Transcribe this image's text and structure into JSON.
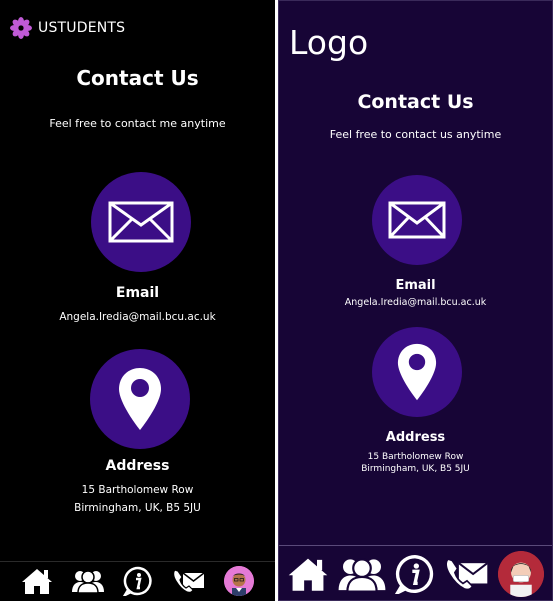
{
  "colors": {
    "accent": "#3b0e86",
    "left_bg": "#000000",
    "right_bg": "#170536",
    "flower": "#c05ad6",
    "avatar_left": "#e57ad6",
    "avatar_right": "#b42a3a"
  },
  "left": {
    "brand": "USTUDENTS",
    "title": "Contact Us",
    "subtitle": "Feel free to contact me anytime",
    "email_label": "Email",
    "email_value": "Angela.Iredia@mail.bcu.ac.uk",
    "address_label": "Address",
    "address_line1": "15 Bartholomew Row",
    "address_line2": "Birmingham, UK, B5 5JU",
    "nav": [
      "home-icon",
      "people-icon",
      "info-icon",
      "contact-icon",
      "avatar"
    ]
  },
  "right": {
    "logo": "Logo",
    "title": "Contact Us",
    "subtitle": "Feel free to contact us anytime",
    "email_label": "Email",
    "email_value": "Angela.Iredia@mail.bcu.ac.uk",
    "address_label": "Address",
    "address_line1": "15 Bartholomew Row",
    "address_line2": "Birmingham, UK, B5 5JU",
    "nav": [
      "home-icon",
      "people-icon",
      "info-icon",
      "contact-icon",
      "avatar"
    ]
  }
}
